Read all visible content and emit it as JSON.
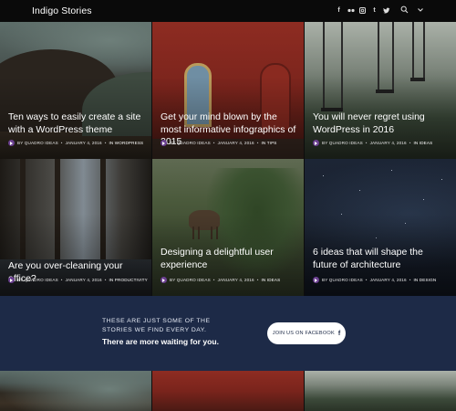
{
  "header": {
    "site_title": "Indigo Stories",
    "social_icons": [
      {
        "name": "facebook-icon",
        "glyph": "f"
      },
      {
        "name": "flickr-icon",
        "glyph": "••"
      },
      {
        "name": "instagram-icon",
        "glyph": "◘"
      },
      {
        "name": "tumblr-icon",
        "glyph": "t"
      },
      {
        "name": "twitter-icon",
        "glyph": "🐦"
      }
    ],
    "tools": [
      "search-icon",
      "chevron-down-icon"
    ]
  },
  "posts": [
    {
      "title": "Ten ways to easily create a site with a WordPress theme",
      "author": "BY QUADRO IDEAS",
      "date": "JANUARY 4, 2016",
      "category": "IN WORDPRESS"
    },
    {
      "title": "Get your mind blown by the most informative infographics of 2015",
      "author": "BY QUADRO IDEAS",
      "date": "JANUARY 4, 2016",
      "category": "IN TIPS"
    },
    {
      "title": "You will never regret using WordPress in 2016",
      "author": "BY QUADRO IDEAS",
      "date": "JANUARY 4, 2016",
      "category": "IN IDEAS"
    },
    {
      "title": "Are you over-cleaning your office?",
      "author": "BY QUADRO IDEAS",
      "date": "JANUARY 4, 2016",
      "category": "IN PRODUCTIVITY"
    },
    {
      "title": "Designing a delightful user experience",
      "author": "BY QUADRO IDEAS",
      "date": "JANUARY 4, 2016",
      "category": "IN IDEAS"
    },
    {
      "title": "6 ideas that will shape the future of architecture",
      "author": "BY QUADRO IDEAS",
      "date": "JANUARY 4, 2016",
      "category": "IN DESIGN"
    }
  ],
  "cta": {
    "small_text": "THESE ARE JUST SOME OF THE STORIES WE FIND EVERY DAY.",
    "big_text": "There are more waiting for you.",
    "button_label": "JOIN US ON FACEBOOK",
    "button_icon": "f"
  },
  "colors": {
    "cta_background": "#1d2a47",
    "header_background": "#0a0a0a",
    "avatar": "#6a3f8f"
  }
}
